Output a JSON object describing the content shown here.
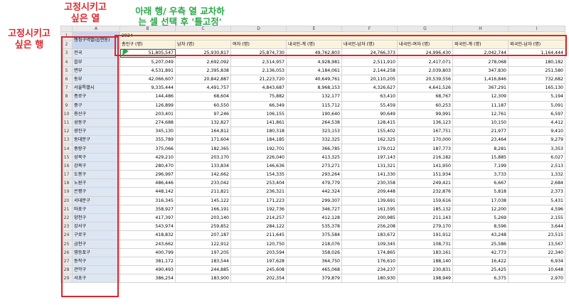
{
  "annotations": {
    "frozen_column": "고정시키고\n싶은 열",
    "frozen_row": "고정시키고\n싶은 행",
    "freeze_hint": "아래 행/ 우측 열 교차하\n는 셀 선택 후 '틀고정'"
  },
  "colors": {
    "annotation_red": "#e0242a",
    "annotation_green": "#2aa84a",
    "selection": "#217346"
  },
  "columns": [
    "A",
    "B",
    "C",
    "D",
    "E",
    "F",
    "G",
    "H",
    "I"
  ],
  "header": {
    "a_label": "행정구역별(읍면동)",
    "year": "2024",
    "cols": [
      "총인구 (명)",
      "남자 (명)",
      "여자 (명)",
      "내국인-계 (명)",
      "내국인-남자 (명)",
      "내국인-여자 (명)",
      "외국인-계 (명)",
      "외국인-남자 (명)"
    ]
  },
  "rows": [
    {
      "n": "3",
      "name": "전국",
      "indent": false,
      "v": [
        "51,805,547",
        "25,930,817",
        "25,874,730",
        "49,762,803",
        "24,766,373",
        "24,996,430",
        "2,042,744",
        "1,164,444"
      ]
    },
    {
      "n": "4",
      "name": "읍부",
      "indent": false,
      "v": [
        "5,207,049",
        "2,692,092",
        "2,514,957",
        "4,928,981",
        "2,511,910",
        "2,417,071",
        "278,068",
        "180,182"
      ]
    },
    {
      "n": "5",
      "name": "면부",
      "indent": false,
      "v": [
        "4,531,891",
        "2,395,838",
        "2,136,053",
        "4,184,061",
        "2,144,258",
        "2,039,803",
        "347,830",
        "251,580"
      ]
    },
    {
      "n": "6",
      "name": "동부",
      "indent": false,
      "v": [
        "42,066,607",
        "20,842,887",
        "21,223,720",
        "40,649,761",
        "20,110,205",
        "20,539,556",
        "1,416,846",
        "732,682"
      ]
    },
    {
      "n": "7",
      "name": "서울특별시",
      "indent": false,
      "v": [
        "9,335,444",
        "4,491,757",
        "4,843,687",
        "8,968,153",
        "4,326,627",
        "4,641,526",
        "367,291",
        "165,130"
      ]
    },
    {
      "n": "8",
      "name": "종로구",
      "indent": true,
      "v": [
        "144,486",
        "68,604",
        "75,882",
        "132,177",
        "63,410",
        "68,767",
        "12,309",
        "5,194"
      ]
    },
    {
      "n": "9",
      "name": "중구",
      "indent": true,
      "v": [
        "126,899",
        "60,550",
        "66,349",
        "115,712",
        "55,459",
        "60,253",
        "11,187",
        "5,091"
      ]
    },
    {
      "n": "10",
      "name": "용산구",
      "indent": true,
      "v": [
        "203,401",
        "97,246",
        "106,155",
        "190,640",
        "90,649",
        "99,991",
        "12,761",
        "6,597"
      ]
    },
    {
      "n": "11",
      "name": "성동구",
      "indent": true,
      "v": [
        "274,688",
        "132,827",
        "141,861",
        "264,538",
        "128,415",
        "136,123",
        "10,150",
        "4,412"
      ]
    },
    {
      "n": "12",
      "name": "광진구",
      "indent": true,
      "v": [
        "345,130",
        "164,812",
        "180,318",
        "323,153",
        "155,402",
        "167,751",
        "21,977",
        "9,410"
      ]
    },
    {
      "n": "13",
      "name": "동대문구",
      "indent": true,
      "v": [
        "355,789",
        "171,604",
        "184,185",
        "332,325",
        "162,325",
        "170,000",
        "23,464",
        "9,279"
      ]
    },
    {
      "n": "14",
      "name": "중랑구",
      "indent": true,
      "v": [
        "375,066",
        "182,365",
        "192,701",
        "366,785",
        "179,012",
        "187,773",
        "8,281",
        "3,353"
      ]
    },
    {
      "n": "15",
      "name": "성북구",
      "indent": true,
      "v": [
        "429,210",
        "203,170",
        "226,040",
        "413,325",
        "197,143",
        "216,182",
        "15,885",
        "6,027"
      ]
    },
    {
      "n": "16",
      "name": "강북구",
      "indent": true,
      "v": [
        "280,470",
        "133,834",
        "146,636",
        "273,271",
        "131,321",
        "141,950",
        "7,199",
        "2,513"
      ]
    },
    {
      "n": "17",
      "name": "도봉구",
      "indent": true,
      "v": [
        "296,997",
        "142,662",
        "154,335",
        "293,264",
        "141,330",
        "151,934",
        "3,733",
        "1,332"
      ]
    },
    {
      "n": "18",
      "name": "노원구",
      "indent": true,
      "v": [
        "486,446",
        "233,042",
        "253,404",
        "479,779",
        "230,358",
        "249,421",
        "6,667",
        "2,684"
      ]
    },
    {
      "n": "19",
      "name": "은평구",
      "indent": true,
      "v": [
        "448,142",
        "211,821",
        "236,321",
        "442,324",
        "209,448",
        "232,876",
        "5,818",
        "2,373"
      ]
    },
    {
      "n": "20",
      "name": "서대문구",
      "indent": true,
      "v": [
        "316,345",
        "145,122",
        "171,223",
        "299,307",
        "139,691",
        "159,616",
        "17,038",
        "5,431"
      ]
    },
    {
      "n": "21",
      "name": "마포구",
      "indent": true,
      "v": [
        "358,927",
        "166,191",
        "192,736",
        "346,727",
        "161,595",
        "185,132",
        "12,200",
        "4,596"
      ]
    },
    {
      "n": "22",
      "name": "양천구",
      "indent": true,
      "v": [
        "417,397",
        "203,140",
        "214,257",
        "412,128",
        "200,985",
        "211,143",
        "5,269",
        "2,155"
      ]
    },
    {
      "n": "23",
      "name": "강서구",
      "indent": true,
      "v": [
        "543,974",
        "259,852",
        "284,122",
        "535,378",
        "256,208",
        "279,170",
        "8,596",
        "3,644"
      ]
    },
    {
      "n": "24",
      "name": "구로구",
      "indent": true,
      "v": [
        "418,832",
        "207,187",
        "211,645",
        "375,584",
        "183,672",
        "191,912",
        "43,248",
        "23,515"
      ]
    },
    {
      "n": "25",
      "name": "금천구",
      "indent": true,
      "v": [
        "243,662",
        "122,912",
        "120,750",
        "218,076",
        "109,345",
        "108,731",
        "25,586",
        "13,567"
      ]
    },
    {
      "n": "26",
      "name": "영등포구",
      "indent": true,
      "v": [
        "400,799",
        "197,205",
        "203,594",
        "358,026",
        "174,865",
        "183,161",
        "42,773",
        "22,340"
      ]
    },
    {
      "n": "27",
      "name": "동작구",
      "indent": true,
      "v": [
        "381,172",
        "183,544",
        "197,628",
        "364,750",
        "176,610",
        "188,140",
        "16,422",
        "6,934"
      ]
    },
    {
      "n": "28",
      "name": "관악구",
      "indent": true,
      "v": [
        "490,493",
        "244,885",
        "245,608",
        "465,068",
        "234,237",
        "230,831",
        "25,425",
        "10,648"
      ]
    },
    {
      "n": "29",
      "name": "서초구",
      "indent": true,
      "v": [
        "386,254",
        "183,900",
        "202,354",
        "379,879",
        "180,930",
        "198,949",
        "6,375",
        "2,970"
      ]
    }
  ]
}
